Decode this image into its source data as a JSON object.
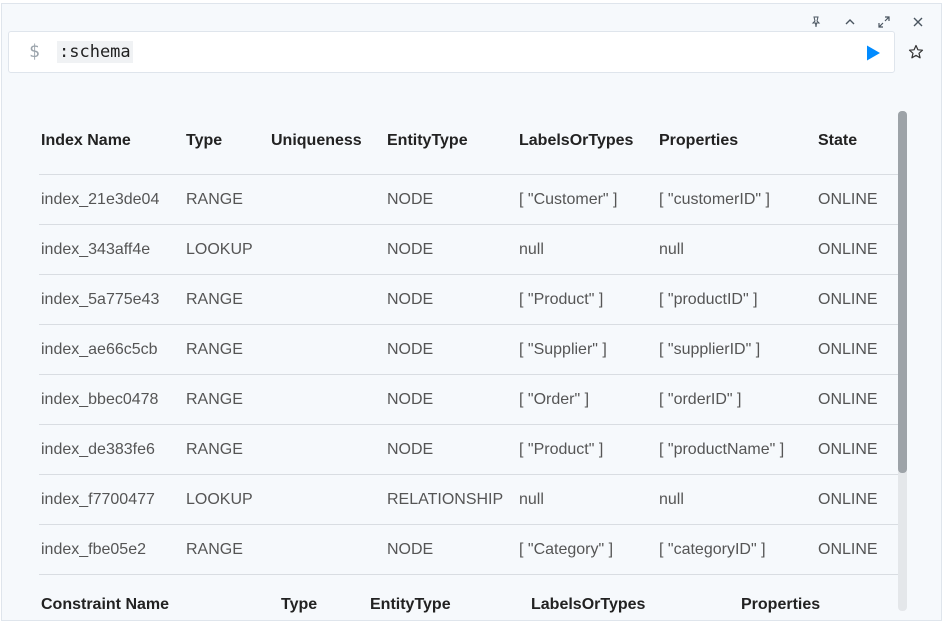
{
  "toolbar": {
    "icons": [
      "pin-icon",
      "collapse-icon",
      "expand-icon",
      "close-icon"
    ]
  },
  "editor": {
    "prompt": "$",
    "command": ":schema",
    "run_icon": "play-icon",
    "favorite_icon": "star-icon"
  },
  "colors": {
    "accent": "#018bff",
    "frame_bg": "#f6f9fc"
  },
  "index_table": {
    "headers": [
      "Index Name",
      "Type",
      "Uniqueness",
      "EntityType",
      "LabelsOrTypes",
      "Properties",
      "State"
    ],
    "rows": [
      [
        "index_21e3de04",
        "RANGE",
        "",
        "NODE",
        "[ \"Customer\" ]",
        "[ \"customerID\" ]",
        "ONLINE"
      ],
      [
        "index_343aff4e",
        "LOOKUP",
        "",
        "NODE",
        "null",
        "null",
        "ONLINE"
      ],
      [
        "index_5a775e43",
        "RANGE",
        "",
        "NODE",
        "[ \"Product\" ]",
        "[ \"productID\" ]",
        "ONLINE"
      ],
      [
        "index_ae66c5cb",
        "RANGE",
        "",
        "NODE",
        "[ \"Supplier\" ]",
        "[ \"supplierID\" ]",
        "ONLINE"
      ],
      [
        "index_bbec0478",
        "RANGE",
        "",
        "NODE",
        "[ \"Order\" ]",
        "[ \"orderID\" ]",
        "ONLINE"
      ],
      [
        "index_de383fe6",
        "RANGE",
        "",
        "NODE",
        "[ \"Product\" ]",
        "[ \"productName\" ]",
        "ONLINE"
      ],
      [
        "index_f7700477",
        "LOOKUP",
        "",
        "RELATIONSHIP",
        "null",
        "null",
        "ONLINE"
      ],
      [
        "index_fbe05e2",
        "RANGE",
        "",
        "NODE",
        "[ \"Category\" ]",
        "[ \"categoryID\" ]",
        "ONLINE"
      ]
    ]
  },
  "constraint_table": {
    "headers": [
      "Constraint Name",
      "Type",
      "EntityType",
      "LabelsOrTypes",
      "Properties"
    ]
  }
}
